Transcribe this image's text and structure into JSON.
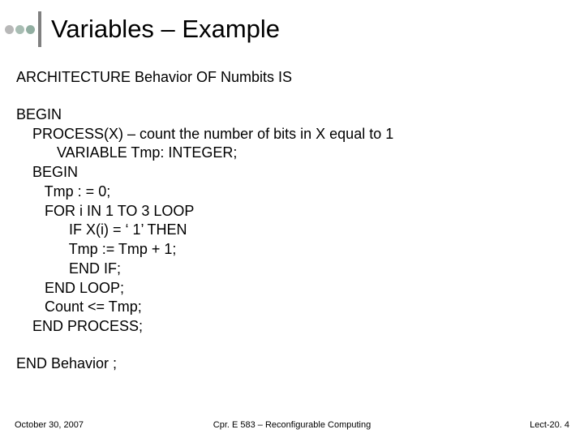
{
  "colors": {
    "dot1": "#b8b8b8",
    "dot2": "#a8bdb3",
    "dot3": "#91aea1",
    "bar": "#808080"
  },
  "title": "Variables – Example",
  "lines": {
    "l0": "ARCHITECTURE Behavior OF Numbits IS",
    "l1": "BEGIN",
    "l2": "    PROCESS(X) – count the number of bits in X equal to 1",
    "l3": "          VARIABLE Tmp: INTEGER;",
    "l4": "    BEGIN",
    "l5": "       Tmp : = 0;",
    "l6": "       FOR i IN 1 TO 3 LOOP",
    "l7": "             IF X(i) = ‘ 1’ THEN",
    "l8": "             Tmp := Tmp + 1;",
    "l9": "             END IF;",
    "l10": "       END LOOP;",
    "l11": "       Count <= Tmp;",
    "l12": "    END PROCESS;",
    "l13": "END Behavior ;"
  },
  "footer": {
    "date": "October 30, 2007",
    "center": "Cpr. E 583 – Reconfigurable Computing",
    "right": "Lect-20. 4"
  }
}
